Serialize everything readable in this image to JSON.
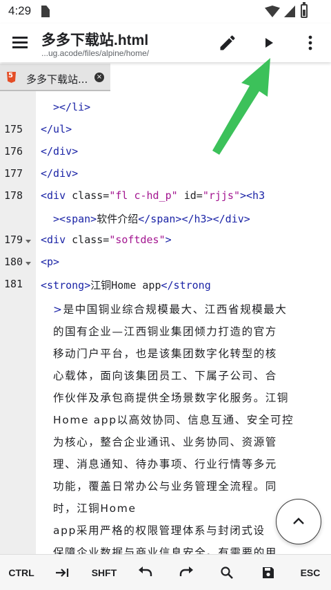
{
  "status_bar": {
    "time": "4:29",
    "icons": [
      "sd-card-icon",
      "wifi-icon",
      "signal-icon",
      "battery-icon"
    ]
  },
  "toolbar": {
    "title": "多多下载站.html",
    "subtitle": "...ug.acode/files/alpine/home/",
    "icons": [
      "menu-icon",
      "edit-icon",
      "run-icon",
      "more-vert-icon"
    ]
  },
  "tab": {
    "label": "多多下载站...",
    "close_symbol": "×"
  },
  "editor": {
    "line_numbers": [
      "175",
      "176",
      "177",
      "178",
      "179",
      "180",
      "181"
    ],
    "lines": {
      "l0": "></li>",
      "l175": "</ul>",
      "l176": "</div>",
      "l177": "</div>",
      "l178a_tag_open": "<div",
      "l178a_attr1": " class=",
      "l178a_val1": "\"fl c-hd_p\"",
      "l178a_attr2": " id=",
      "l178a_val2": "\"rjjs\"",
      "l178a_tag_close": "><h3",
      "l178b_open": "><span>",
      "l178b_text": "软件介绍",
      "l178b_close": "</span></h3></div>",
      "l179_tag": "<div",
      "l179_attr": " class=",
      "l179_val": "\"softdes\"",
      "l179_end": ">",
      "l180": "<p>",
      "l181_open": "<strong>",
      "l181_text": "江铜Home app",
      "l181_close": "</strong",
      "p1_gt": ">",
      "p1": "是中国铜业综合规模最大、江西省规模最大",
      "p2": "的国有企业—江西铜业集团倾力打造的官方",
      "p3": "移动门户平台，也是该集团数字化转型的核",
      "p4": "心载体，面向该集团员工、下属子公司、合",
      "p5": "作伙伴及承包商提供全场景数字化服务。江铜",
      "p6": "Home app以高效协同、信息互通、安全可控",
      "p7": "为核心，整合企业通讯、业务协同、资源管",
      "p8": "理、消息通知、待办事项、行业行情等多元",
      "p9": "功能，覆盖日常办公与业务管理全流程。同",
      "p10": "时，江铜Home",
      "p11": "app采用严格的权限管理体系与封闭式设",
      "p12": "保障企业数据与商业信息安全。有需要的用"
    }
  },
  "fab": {
    "icon": "chevron-up-icon"
  },
  "bottom_bar": {
    "keys": [
      "CTRL",
      "SHFT",
      "ESC"
    ],
    "icons": [
      "tab-key-icon",
      "undo-icon",
      "redo-icon",
      "search-icon",
      "save-icon"
    ]
  },
  "colors": {
    "tag": "#1a23a6",
    "string": "#a31590",
    "gutter": "#eeeeee",
    "arrow": "#3cc15a"
  }
}
